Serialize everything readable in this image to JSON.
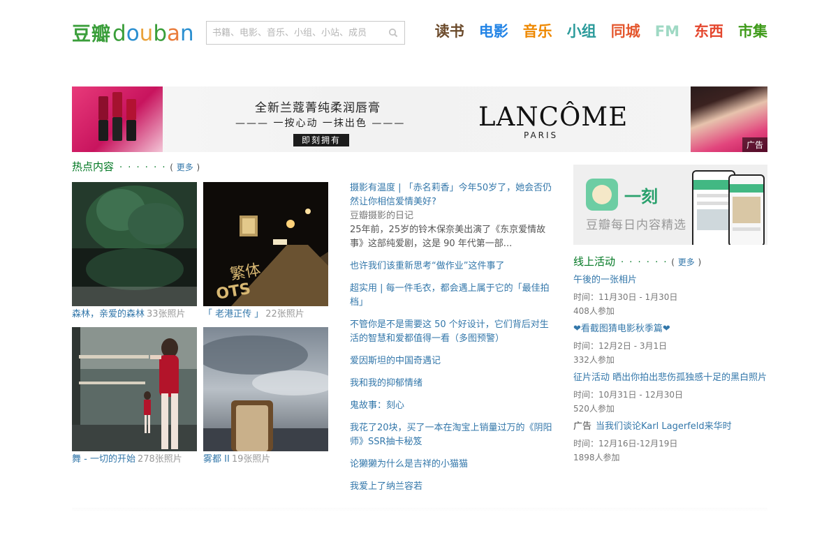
{
  "header": {
    "logo_cn": "豆瓣",
    "logo_en_letters": [
      "d",
      "o",
      "u",
      "b",
      "a",
      "n"
    ],
    "logo_en_colors": [
      "#3a9e3a",
      "#2b8fd0",
      "#e9a23b",
      "#3a9e3a",
      "#e97c3b",
      "#2b8fd0"
    ],
    "search_placeholder": "书籍、电影、音乐、小组、小站、成员",
    "nav": [
      {
        "label": "读书",
        "color": "#6b4a2b"
      },
      {
        "label": "电影",
        "color": "#2384e6"
      },
      {
        "label": "音乐",
        "color": "#ee8800"
      },
      {
        "label": "小组",
        "color": "#2a9a9a"
      },
      {
        "label": "同城",
        "color": "#e4572e"
      },
      {
        "label": "FM",
        "color": "#9fd9c4"
      },
      {
        "label": "东西",
        "color": "#e4472e"
      },
      {
        "label": "市集",
        "color": "#3f9b1a"
      }
    ]
  },
  "banner": {
    "line1": "全新兰蔻菁纯柔润唇膏",
    "line2": "——— 一按心动  一抹出色 ———",
    "button": "即刻拥有",
    "brand": "LANCÔME",
    "brand_sub": "PARIS",
    "ad_tag": "广告"
  },
  "hot": {
    "title": "热点内容",
    "dots": "· · · · · ·",
    "more": "更多",
    "albums": [
      {
        "title": "森林，亲爱的森林",
        "count": "33张照片"
      },
      {
        "title": "「 老港正传 」",
        "count": "22张照片"
      },
      {
        "title": "舞 - 一切的开始",
        "count": "278张照片"
      },
      {
        "title": "雾都 II",
        "count": "19张照片"
      }
    ],
    "lead": {
      "title": "摄影有温度 | 「赤名莉香」今年50岁了，她会否仍然让你相信爱情美好?",
      "source": "豆瓣摄影的日记",
      "desc": "25年前，25岁的铃木保奈美出演了《东京爱情故事》这部纯爱剧，这是 90 年代第一部..."
    },
    "items": [
      "也许我们该重新思考“做作业”这件事了",
      "超实用 | 每一件毛衣，都会遇上属于它的「最佳拍档」",
      "不管你是不是需要这 50 个好设计，它们背后对生活的智慧和爱都值得一看（多图预警）",
      "爱因斯坦的中国奇遇记",
      "我和我的抑郁情绪",
      "鬼故事：刻心",
      "我花了20块，买了一本在淘宝上销量过万的《阴阳师》SSR抽卡秘笈",
      "论獭獭为什么是吉祥的小猫猫",
      "我爱上了纳兰容若"
    ]
  },
  "app_ad": {
    "name": "一刻",
    "desc": "豆瓣每日内容精选"
  },
  "events": {
    "title": "线上活动",
    "dots": "· · · · · ·",
    "more": "更多",
    "items": [
      {
        "ad": "",
        "title": "午後的一张相片",
        "time": "时间：11月30日 - 1月30日",
        "people": "408人参加"
      },
      {
        "ad": "",
        "title": "❤看截图猜电影秋季篇❤",
        "time": "时间：12月2日 - 3月1日",
        "people": "332人参加"
      },
      {
        "ad": "",
        "title": "征片活动 晒出你拍出悲伤孤独感十足的黑白照片",
        "time": "时间：10月31日 - 12月30日",
        "people": "520人参加"
      },
      {
        "ad": "广告",
        "title": "当我们谈论Karl Lagerfeld来华时",
        "time": "时间：12月16日-12月19日",
        "people": "1898人参加"
      }
    ]
  }
}
